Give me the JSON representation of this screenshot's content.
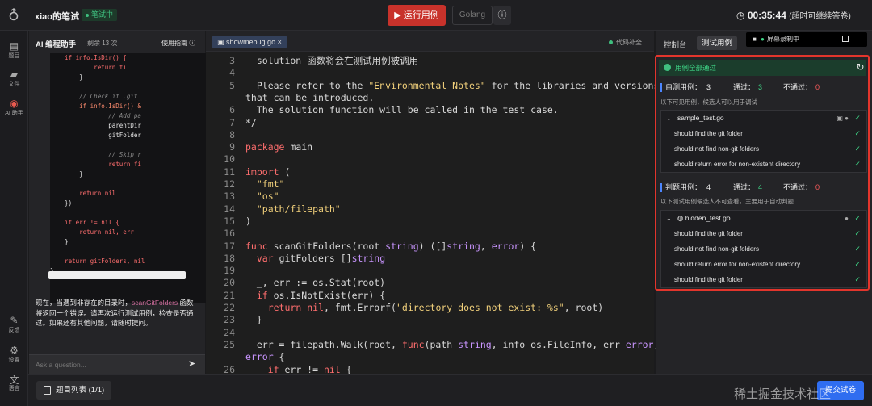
{
  "topbar": {
    "app_title": "xiao的笔试",
    "badge": "笔试中",
    "run_label": "运行用例",
    "language": "Golang",
    "info_icon": "info-icon",
    "timer": "00:35:44",
    "timer_note": "(超时可继续答卷)"
  },
  "rail": {
    "items": [
      {
        "label": "题目",
        "icon": "question-list-icon"
      },
      {
        "label": "文件",
        "icon": "folder-icon"
      },
      {
        "label": "AI 助手",
        "icon": "robot-icon"
      },
      {
        "label": "反馈",
        "icon": "feedback-icon"
      },
      {
        "label": "设置",
        "icon": "gear-icon"
      },
      {
        "label": "语言",
        "icon": "language-icon"
      }
    ]
  },
  "ai": {
    "title": "AI 编程助手",
    "remaining": "剩余 13 次",
    "guide": "使用指南",
    "code_lines": [
      "    if info.IsDir() {",
      "            return fi",
      "        }",
      "",
      "        // Check if .git",
      "        if info.IsDir() &",
      "                // Add pa",
      "                parentDir",
      "                gitFolder",
      "",
      "                // Skip r",
      "                return fi",
      "        }",
      "",
      "        return nil",
      "    })",
      "",
      "    if err != nil {",
      "        return nil, err",
      "    }",
      "",
      "    return gitFolders, nil",
      "}"
    ],
    "answer_before": "现在，当遇到非存在的目录时，",
    "answer_fn": "scanGitFolders",
    "answer_after": " 函数将返回一个错误。请再次运行测试用例，检查是否通过。如果还有其他问题，请随时提问。",
    "ask_placeholder": "Ask a question..."
  },
  "editor": {
    "file_tab": "showmebug.go",
    "completion": "代码补全",
    "lines": [
      {
        "n": "3",
        "t": "  solution 函数将会在测试用例被调用"
      },
      {
        "n": "4",
        "t": ""
      },
      {
        "n": "5",
        "t": "  Please refer to the \"Environmental Notes\" for the libraries and versions"
      },
      {
        "n": "",
        "t": "that can be introduced."
      },
      {
        "n": "6",
        "t": "  The solution function will be called in the test case."
      },
      {
        "n": "7",
        "t": "*/"
      },
      {
        "n": "8",
        "t": ""
      },
      {
        "n": "9",
        "t": "package main"
      },
      {
        "n": "10",
        "t": ""
      },
      {
        "n": "11",
        "t": "import ("
      },
      {
        "n": "12",
        "t": "  \"fmt\""
      },
      {
        "n": "13",
        "t": "  \"os\""
      },
      {
        "n": "14",
        "t": "  \"path/filepath\""
      },
      {
        "n": "15",
        "t": ")"
      },
      {
        "n": "16",
        "t": ""
      },
      {
        "n": "17",
        "t": "func scanGitFolders(root string) ([]string, error) {"
      },
      {
        "n": "18",
        "t": "  var gitFolders []string"
      },
      {
        "n": "19",
        "t": ""
      },
      {
        "n": "20",
        "t": "  _, err := os.Stat(root)"
      },
      {
        "n": "21",
        "t": "  if os.IsNotExist(err) {"
      },
      {
        "n": "22",
        "t": "    return nil, fmt.Errorf(\"directory does not exist: %s\", root)"
      },
      {
        "n": "23",
        "t": "  }"
      },
      {
        "n": "24",
        "t": ""
      },
      {
        "n": "25",
        "t": "  err = filepath.Walk(root, func(path string, info os.FileInfo, err error)"
      },
      {
        "n": "",
        "t": "error {"
      },
      {
        "n": "26",
        "t": "    if err != nil {"
      }
    ]
  },
  "results": {
    "tab_console": "控制台",
    "tab_testcases": "测试用例",
    "recording": "屏幕录制中",
    "all_passed": "用例全部通过",
    "custom_label": "自测用例：",
    "custom_total": "3",
    "passed_label": "通过：",
    "custom_passed": "3",
    "failed_label": "不通过：",
    "custom_failed": "0",
    "custom_note": "以下可见用例，候选人可以用于调试",
    "sample_file": "sample_test.go",
    "sample_cases": [
      "should find the git folder",
      "should not find non-git folders",
      "should return error for non-existent directory"
    ],
    "judge_label": "判题用例：",
    "judge_total": "4",
    "judge_passed": "4",
    "judge_failed": "0",
    "judge_note": "以下测试用例候选人不可查看，主要用于自动判题",
    "hidden_file": "hidden_test.go",
    "hidden_cases": [
      "should find the git folder",
      "should not find non-git folders",
      "should return error for non-existent directory",
      "should find the git folder"
    ]
  },
  "bottom": {
    "problem_list": "题目列表 (1/1)",
    "submit": "提交试卷",
    "watermark": "稀土掘金技术社区"
  },
  "colors": {
    "accent_red": "#c8322b",
    "pass_green": "#3fd687",
    "primary_blue": "#2f6df0"
  }
}
